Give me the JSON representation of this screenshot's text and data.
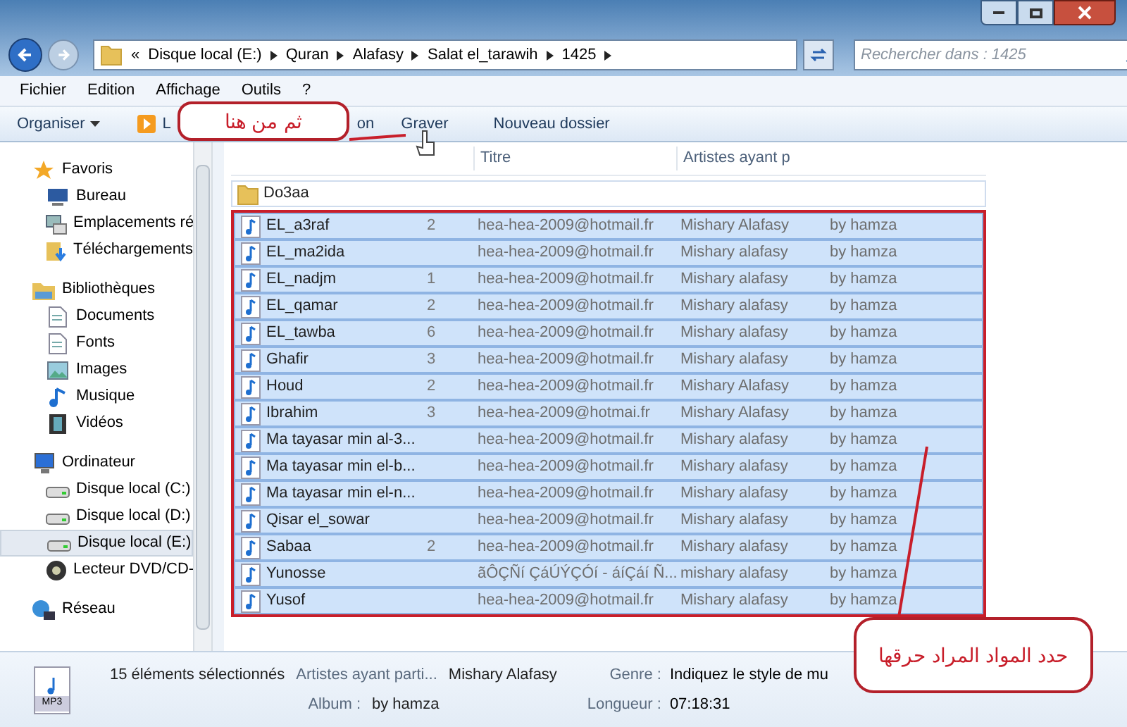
{
  "address": {
    "crumbs": [
      "Disque local (E:)",
      "Quran",
      "Alafasy",
      "Salat el_tarawih",
      "1425"
    ],
    "overflow": "«"
  },
  "search": {
    "placeholder": "Rechercher dans : 1425"
  },
  "menu": [
    "Fichier",
    "Edition",
    "Affichage",
    "Outils",
    "?"
  ],
  "toolbar": [
    {
      "kind": "menu",
      "label": "Organiser"
    },
    {
      "kind": "play",
      "label": "L"
    },
    {
      "kind": "plain",
      "label": "on"
    },
    {
      "kind": "plain",
      "label": "Graver"
    },
    {
      "kind": "plain",
      "label": "Nouveau dossier"
    }
  ],
  "sidebar": [
    {
      "kind": "header",
      "label": "Favoris",
      "selected": false
    },
    {
      "kind": "item",
      "label": "Bureau",
      "selected": false
    },
    {
      "kind": "item",
      "label": "Emplacements ré",
      "selected": false
    },
    {
      "kind": "item",
      "label": "Téléchargements",
      "selected": false
    },
    {
      "kind": "header",
      "label": "Bibliothèques",
      "selected": false
    },
    {
      "kind": "item",
      "label": "Documents",
      "selected": false
    },
    {
      "kind": "item",
      "label": "Fonts",
      "selected": false
    },
    {
      "kind": "item",
      "label": "Images",
      "selected": false
    },
    {
      "kind": "item",
      "label": "Musique",
      "selected": false
    },
    {
      "kind": "item",
      "label": "Vidéos",
      "selected": false
    },
    {
      "kind": "header",
      "label": "Ordinateur",
      "selected": false
    },
    {
      "kind": "item",
      "label": "Disque local (C:)",
      "selected": false
    },
    {
      "kind": "item",
      "label": "Disque local (D:)",
      "selected": false
    },
    {
      "kind": "item",
      "label": "Disque local (E:)",
      "selected": true
    },
    {
      "kind": "item",
      "label": "Lecteur DVD/CD-",
      "selected": false
    },
    {
      "kind": "header",
      "label": "Réseau",
      "selected": false
    }
  ],
  "columns": [
    "Titre",
    "Artistes ayant p"
  ],
  "rows": [
    {
      "kind": "folder",
      "name": "Do3aa",
      "selected": false
    },
    {
      "kind": "audio",
      "name": "EL_a3raf",
      "number": "2",
      "title": "hea-hea-2009@hotmail.fr",
      "artist": "Mishary Alafasy",
      "album": "by hamza",
      "selected": true
    },
    {
      "kind": "audio",
      "name": "EL_ma2ida",
      "title": "hea-hea-2009@hotmail.fr",
      "artist": "Mishary alafasy",
      "album": "by hamza",
      "selected": true
    },
    {
      "kind": "audio",
      "name": "EL_nadjm",
      "number": "1",
      "title": "hea-hea-2009@hotmail.fr",
      "artist": "Mishary alafasy",
      "album": "by hamza",
      "selected": true
    },
    {
      "kind": "audio",
      "name": "EL_qamar",
      "number": "2",
      "title": "hea-hea-2009@hotmail.fr",
      "artist": "Mishary alafasy",
      "album": "by hamza",
      "selected": true
    },
    {
      "kind": "audio",
      "name": "EL_tawba",
      "number": "6",
      "title": "hea-hea-2009@hotmail.fr",
      "artist": "Mishary alafasy",
      "album": "by hamza",
      "selected": true
    },
    {
      "kind": "audio",
      "name": "Ghafir",
      "number": "3",
      "title": "hea-hea-2009@hotmail.fr",
      "artist": "Mishary alafasy",
      "album": "by hamza",
      "selected": true
    },
    {
      "kind": "audio",
      "name": "Houd",
      "number": "2",
      "title": "hea-hea-2009@hotmail.fr",
      "artist": "Mishary Alafasy",
      "album": "by hamza",
      "selected": true
    },
    {
      "kind": "audio",
      "name": "Ibrahim",
      "number": "3",
      "title": "hea-hea-2009@hotmai.fr",
      "artist": "Mishary Alafasy",
      "album": "by hamza",
      "selected": true
    },
    {
      "kind": "audio",
      "name": "Ma tayasar min al-3...",
      "title": "hea-hea-2009@hotmail.fr",
      "artist": "Mishary alafasy",
      "album": "by hamza",
      "selected": true
    },
    {
      "kind": "audio",
      "name": "Ma tayasar min el-b...",
      "title": "hea-hea-2009@hotmail.fr",
      "artist": "Mishary alafasy",
      "album": "by hamza",
      "selected": true
    },
    {
      "kind": "audio",
      "name": "Ma tayasar min el-n...",
      "title": "hea-hea-2009@hotmail.fr",
      "artist": "Mishary alafasy",
      "album": "by hamza",
      "selected": true
    },
    {
      "kind": "audio",
      "name": "Qisar el_sowar",
      "title": "hea-hea-2009@hotmail.fr",
      "artist": "Mishary alafasy",
      "album": "by hamza",
      "selected": true
    },
    {
      "kind": "audio",
      "name": "Sabaa",
      "number": "2",
      "title": "hea-hea-2009@hotmail.fr",
      "artist": "Mishary alafasy",
      "album": "by hamza",
      "selected": true
    },
    {
      "kind": "audio",
      "name": "Yunosse",
      "title": "ãÔÇÑí ÇáÚÝÇÓí - áíÇáí Ñ...",
      "artist": "mishary alafasy",
      "album": "by hamza",
      "selected": true
    },
    {
      "kind": "audio",
      "name": "Yusof",
      "title": "hea-hea-2009@hotmail.fr",
      "artist": "Mishary alafasy",
      "album": "by hamza",
      "selected": true
    }
  ],
  "details": {
    "file_badge": "MP3",
    "count": "15 éléments sélectionnés",
    "fields": [
      {
        "label": "Artistes ayant parti...",
        "value": "Mishary Alafasy"
      },
      {
        "label": "Album :",
        "value": "by hamza"
      },
      {
        "label": "Genre :",
        "value": "Indiquez le style de mu"
      },
      {
        "label": "Longueur :",
        "value": "07:18:31"
      }
    ]
  },
  "callouts": [
    {
      "kind": "top",
      "text": "ثم من هنا"
    },
    {
      "kind": "bottom",
      "text": "حدد المواد المراد حرقها"
    }
  ]
}
